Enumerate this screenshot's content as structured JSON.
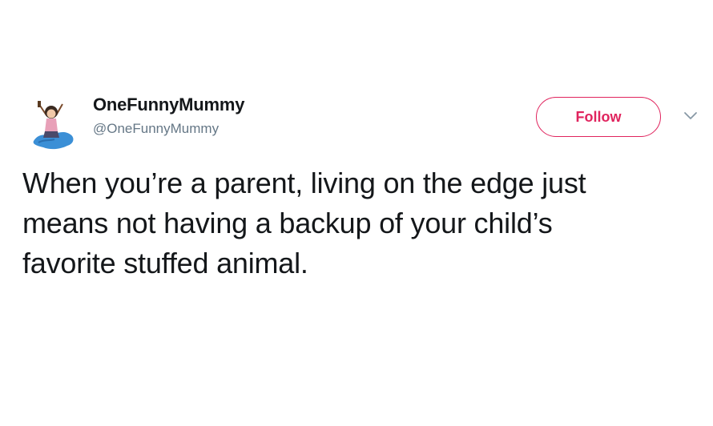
{
  "tweet": {
    "display_name": "OneFunnyMummy",
    "handle": "@OneFunnyMummy",
    "follow_label": "Follow",
    "text_lines": [
      "When you’re a parent, living on the edge just",
      "means not having a backup of your child’s",
      "favorite stuffed animal."
    ]
  },
  "icons": {
    "avatar": "avatar-illustration",
    "menu": "chevron-down-icon"
  },
  "colors": {
    "follow_accent": "#e0245e",
    "handle_gray": "#657786",
    "text": "#14171a"
  }
}
